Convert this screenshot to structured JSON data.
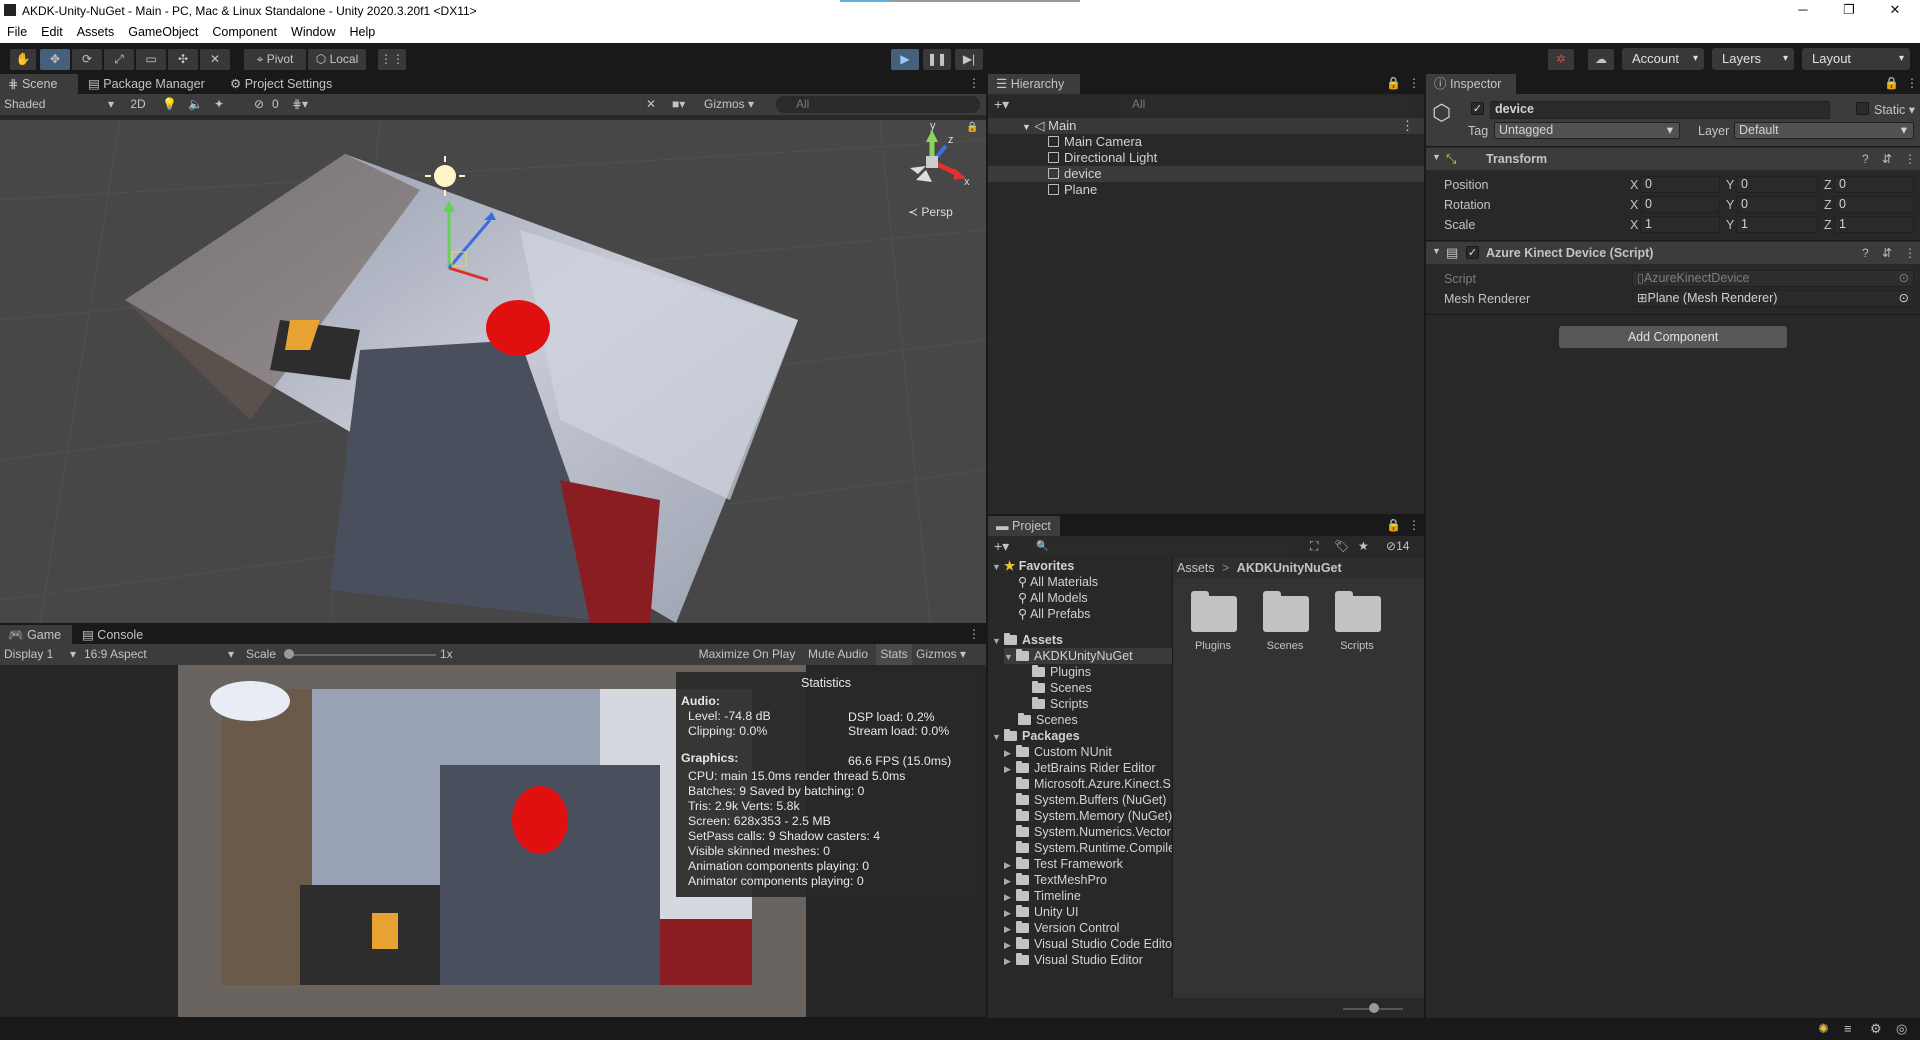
{
  "window": {
    "title": "AKDK-Unity-NuGet - Main - PC, Mac & Linux Standalone - Unity 2020.3.20f1 <DX11>"
  },
  "menu": [
    "File",
    "Edit",
    "Assets",
    "GameObject",
    "Component",
    "Window",
    "Help"
  ],
  "toolbar": {
    "pivot": "Pivot",
    "local": "Local",
    "account": "Account",
    "layers": "Layers",
    "layout": "Layout"
  },
  "scene": {
    "tab_scene": "Scene",
    "tab_package_manager": "Package Manager",
    "tab_project_settings": "Project Settings",
    "shading": "Shaded",
    "mode_2d": "2D",
    "hidden_count": "0",
    "gizmos": "Gizmos",
    "search_placeholder": "All",
    "persp": "Persp",
    "axis_x": "x",
    "axis_y": "y",
    "axis_z": "z"
  },
  "game": {
    "tab_game": "Game",
    "tab_console": "Console",
    "display": "Display 1",
    "aspect": "16:9 Aspect",
    "scale_label": "Scale",
    "scale_value": "1x",
    "maximize": "Maximize On Play",
    "mute": "Mute Audio",
    "stats": "Stats",
    "gizmos": "Gizmos"
  },
  "statistics": {
    "title": "Statistics",
    "audio_heading": "Audio:",
    "level": "Level: -74.8 dB",
    "dsp": "DSP load: 0.2%",
    "clipping": "Clipping: 0.0%",
    "stream": "Stream load: 0.0%",
    "graphics_heading": "Graphics:",
    "fps": "66.6 FPS (15.0ms)",
    "cpu": "CPU: main 15.0ms  render thread 5.0ms",
    "batches": "Batches: 9     Saved by batching: 0",
    "tris": "Tris: 2.9k         Verts: 5.8k",
    "screen": "Screen: 628x353 - 2.5 MB",
    "setpass": "SetPass calls: 9          Shadow casters: 4",
    "skinned": "Visible skinned meshes: 0",
    "animation": "Animation components playing: 0",
    "animator": "Animator components playing: 0"
  },
  "hierarchy": {
    "tab": "Hierarchy",
    "search_placeholder": "All",
    "scene_name": "Main",
    "items": [
      "Main Camera",
      "Directional Light",
      "device",
      "Plane"
    ]
  },
  "project": {
    "tab": "Project",
    "item_count": "14",
    "favorites": "Favorites",
    "fav_items": [
      "All Materials",
      "All Models",
      "All Prefabs"
    ],
    "assets": "Assets",
    "akdk": "AKDKUnityNuGet",
    "akdk_children": [
      "Plugins",
      "Scenes",
      "Scripts"
    ],
    "scenes": "Scenes",
    "packages": "Packages",
    "package_items": [
      {
        "name": "Custom NUnit",
        "expandable": true
      },
      {
        "name": "JetBrains Rider Editor",
        "expandable": true
      },
      {
        "name": "Microsoft.Azure.Kinect.S",
        "expandable": false
      },
      {
        "name": "System.Buffers (NuGet)",
        "expandable": false
      },
      {
        "name": "System.Memory (NuGet)",
        "expandable": false
      },
      {
        "name": "System.Numerics.Vector",
        "expandable": false
      },
      {
        "name": "System.Runtime.Compile",
        "expandable": false
      },
      {
        "name": "Test Framework",
        "expandable": true
      },
      {
        "name": "TextMeshPro",
        "expandable": true
      },
      {
        "name": "Timeline",
        "expandable": true
      },
      {
        "name": "Unity UI",
        "expandable": true
      },
      {
        "name": "Version Control",
        "expandable": true
      },
      {
        "name": "Visual Studio Code Edito",
        "expandable": true
      },
      {
        "name": "Visual Studio Editor",
        "expandable": true
      }
    ],
    "breadcrumb_root": "Assets",
    "breadcrumb_sep": ">",
    "breadcrumb_current": "AKDKUnityNuGet",
    "grid": [
      "Plugins",
      "Scenes",
      "Scripts"
    ]
  },
  "inspector": {
    "tab": "Inspector",
    "object_name": "device",
    "static_label": "Static",
    "tag_label": "Tag",
    "tag_value": "Untagged",
    "layer_label": "Layer",
    "layer_value": "Default",
    "transform_title": "Transform",
    "position": {
      "label": "Position",
      "x": "0",
      "y": "0",
      "z": "0"
    },
    "rotation": {
      "label": "Rotation",
      "x": "0",
      "y": "0",
      "z": "0"
    },
    "scale": {
      "label": "Scale",
      "x": "1",
      "y": "1",
      "z": "1"
    },
    "axis_x": "X",
    "axis_y": "Y",
    "axis_z": "Z",
    "script_component": "Azure Kinect Device (Script)",
    "script_label": "Script",
    "script_value": "AzureKinectDevice",
    "mesh_label": "Mesh Renderer",
    "mesh_value": "Plane (Mesh Renderer)",
    "add_component": "Add Component"
  },
  "colors": {
    "accent": "#46607c",
    "panel": "#282828",
    "header": "#3c3c3c"
  }
}
